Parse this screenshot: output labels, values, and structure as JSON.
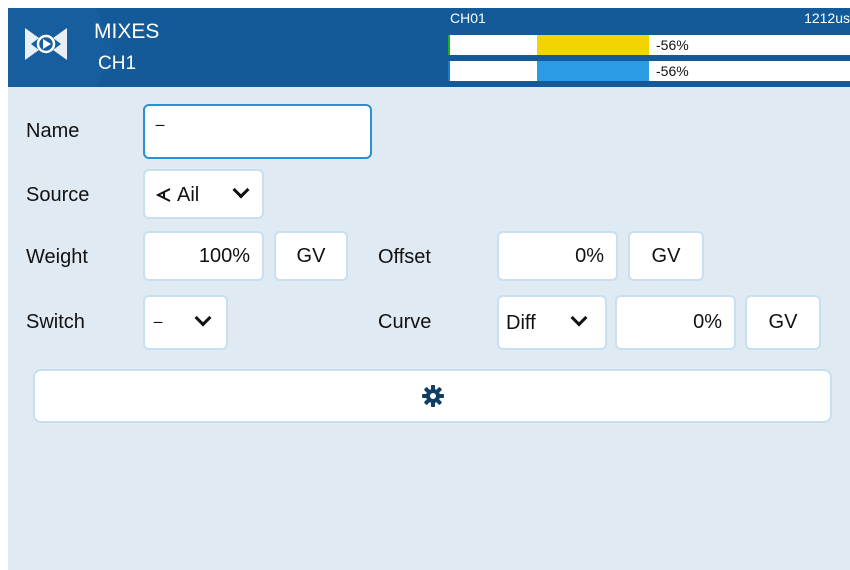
{
  "header": {
    "title": "MIXES",
    "subtitle": "CH1",
    "channel_label": "CH01",
    "channel_us": "1212us",
    "bars": [
      {
        "value_text": "-56%",
        "fill_color": "#f3d400",
        "value_percent": -56
      },
      {
        "value_text": "-56%",
        "fill_color": "#2c9be6",
        "value_percent": -56
      }
    ]
  },
  "form": {
    "name_label": "Name",
    "name_value": "---",
    "source_label": "Source",
    "source_value": "Ail",
    "weight_label": "Weight",
    "weight_value": "100%",
    "weight_gv": "GV",
    "offset_label": "Offset",
    "offset_value": "0%",
    "offset_gv": "GV",
    "switch_label": "Switch",
    "switch_value": "---",
    "curve_label": "Curve",
    "curve_type": "Diff",
    "curve_value": "0%",
    "curve_gv": "GV"
  },
  "colors": {
    "header_bg": "#145a98",
    "screen_bg": "#e0eaf2",
    "field_border": "#c7dfee",
    "focus_border": "#2b8fd2"
  },
  "icons": {
    "app": "mixer-logo-icon",
    "source": "stick-icon",
    "settings": "gear-icon"
  }
}
